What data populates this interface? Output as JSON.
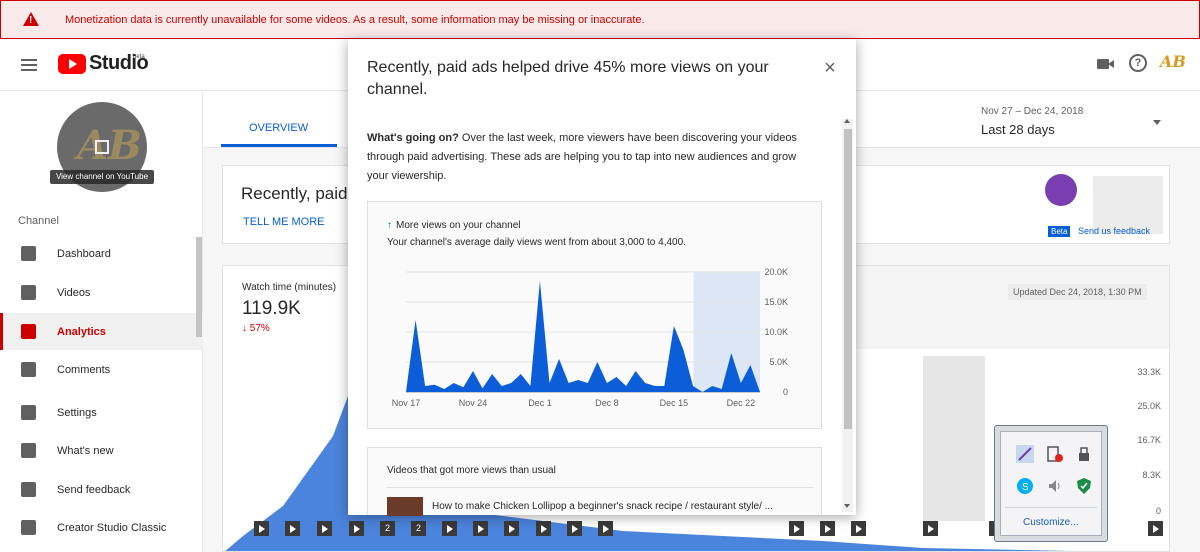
{
  "warning": {
    "message": "Monetization data is currently unavailable for some videos. As a result, some information may be missing or inaccurate."
  },
  "header": {
    "brand": "Studio",
    "beta": "beta"
  },
  "sidebar": {
    "view_channel": "View channel on YouTube",
    "section": "Channel",
    "items": [
      {
        "label": "Dashboard",
        "icon": "dashboard-icon"
      },
      {
        "label": "Videos",
        "icon": "videos-icon"
      },
      {
        "label": "Analytics",
        "icon": "analytics-icon",
        "active": true
      },
      {
        "label": "Comments",
        "icon": "comments-icon"
      },
      {
        "label": "Settings",
        "icon": "gear-icon"
      },
      {
        "label": "What's new",
        "icon": "whats-new-icon"
      },
      {
        "label": "Send feedback",
        "icon": "feedback-icon"
      },
      {
        "label": "Creator Studio Classic",
        "icon": "classic-icon"
      }
    ]
  },
  "main": {
    "tab_overview": "OVERVIEW",
    "date_range": "Nov 27 – Dec 24, 2018",
    "date_label": "Last 28 days",
    "card1": {
      "title": "Recently, paid a",
      "tell_me_more": "TELL ME MORE",
      "beta": "Beta",
      "feedback": "Send us feedback"
    },
    "card2": {
      "watch_time_label": "Watch time (minutes)",
      "watch_time_value": "119.9K",
      "watch_time_change": "↓ 57%",
      "updated": "Updated Dec 24, 2018, 1:30 PM",
      "yticks": [
        "33.3K",
        "25.0K",
        "16.7K",
        "8.3K",
        "0"
      ],
      "buttons": [
        "▶",
        "▶",
        "▶",
        "▶",
        "2",
        "2",
        "▶",
        "▶",
        "▶",
        "▶",
        "▶",
        "▶",
        "▶",
        "▶",
        "▶",
        "▶",
        "▶",
        "▶"
      ]
    }
  },
  "modal": {
    "title": "Recently, paid ads helped drive 45% more views on your channel.",
    "body_lead": "What's going on?",
    "body_text": " Over the last week, more viewers have been discovering your videos through paid advertising. These ads are helping you to tap into new audiences and grow your viewership.",
    "chart_box": {
      "title": "More views on your channel",
      "subtitle": "Your channel's average daily views went from about 3,000 to 4,400."
    },
    "videos_box": {
      "title": "Videos that got more views than usual",
      "first_video": "How to make Chicken Lollipop a beginner's snack recipe / restaurant style/ ..."
    }
  },
  "tray": {
    "customize": "Customize..."
  },
  "colors": {
    "accent": "#065fd4",
    "warning": "#cc0000",
    "area": "#0b5ed7",
    "highlight": "#dce6f5"
  },
  "chart_data": {
    "type": "area",
    "x": [
      "Nov 17",
      "Nov 18",
      "Nov 19",
      "Nov 20",
      "Nov 21",
      "Nov 22",
      "Nov 23",
      "Nov 24",
      "Nov 25",
      "Nov 26",
      "Nov 27",
      "Nov 28",
      "Nov 29",
      "Nov 30",
      "Dec 1",
      "Dec 2",
      "Dec 3",
      "Dec 4",
      "Dec 5",
      "Dec 6",
      "Dec 7",
      "Dec 8",
      "Dec 9",
      "Dec 10",
      "Dec 11",
      "Dec 12",
      "Dec 13",
      "Dec 14",
      "Dec 15",
      "Dec 16",
      "Dec 17",
      "Dec 18",
      "Dec 19",
      "Dec 20",
      "Dec 21",
      "Dec 22",
      "Dec 23",
      "Dec 24"
    ],
    "values": [
      0,
      12000,
      1000,
      1200,
      500,
      1500,
      800,
      3500,
      600,
      3000,
      1000,
      1500,
      3000,
      1000,
      18500,
      1500,
      5500,
      1500,
      2000,
      1500,
      5000,
      1500,
      2500,
      1000,
      3500,
      1500,
      1000,
      1000,
      11000,
      7000,
      1000,
      0,
      1000,
      500,
      6500,
      1500,
      4500,
      0
    ],
    "xticks": [
      "Nov 17",
      "Nov 24",
      "Dec 1",
      "Dec 8",
      "Dec 15",
      "Dec 22"
    ],
    "yticks": [
      "20.0K",
      "15.0K",
      "10.0K",
      "5.0K",
      "0"
    ],
    "ylim": [
      0,
      20000
    ],
    "highlight_range": [
      "Dec 18",
      "Dec 24"
    ],
    "grid": true
  }
}
